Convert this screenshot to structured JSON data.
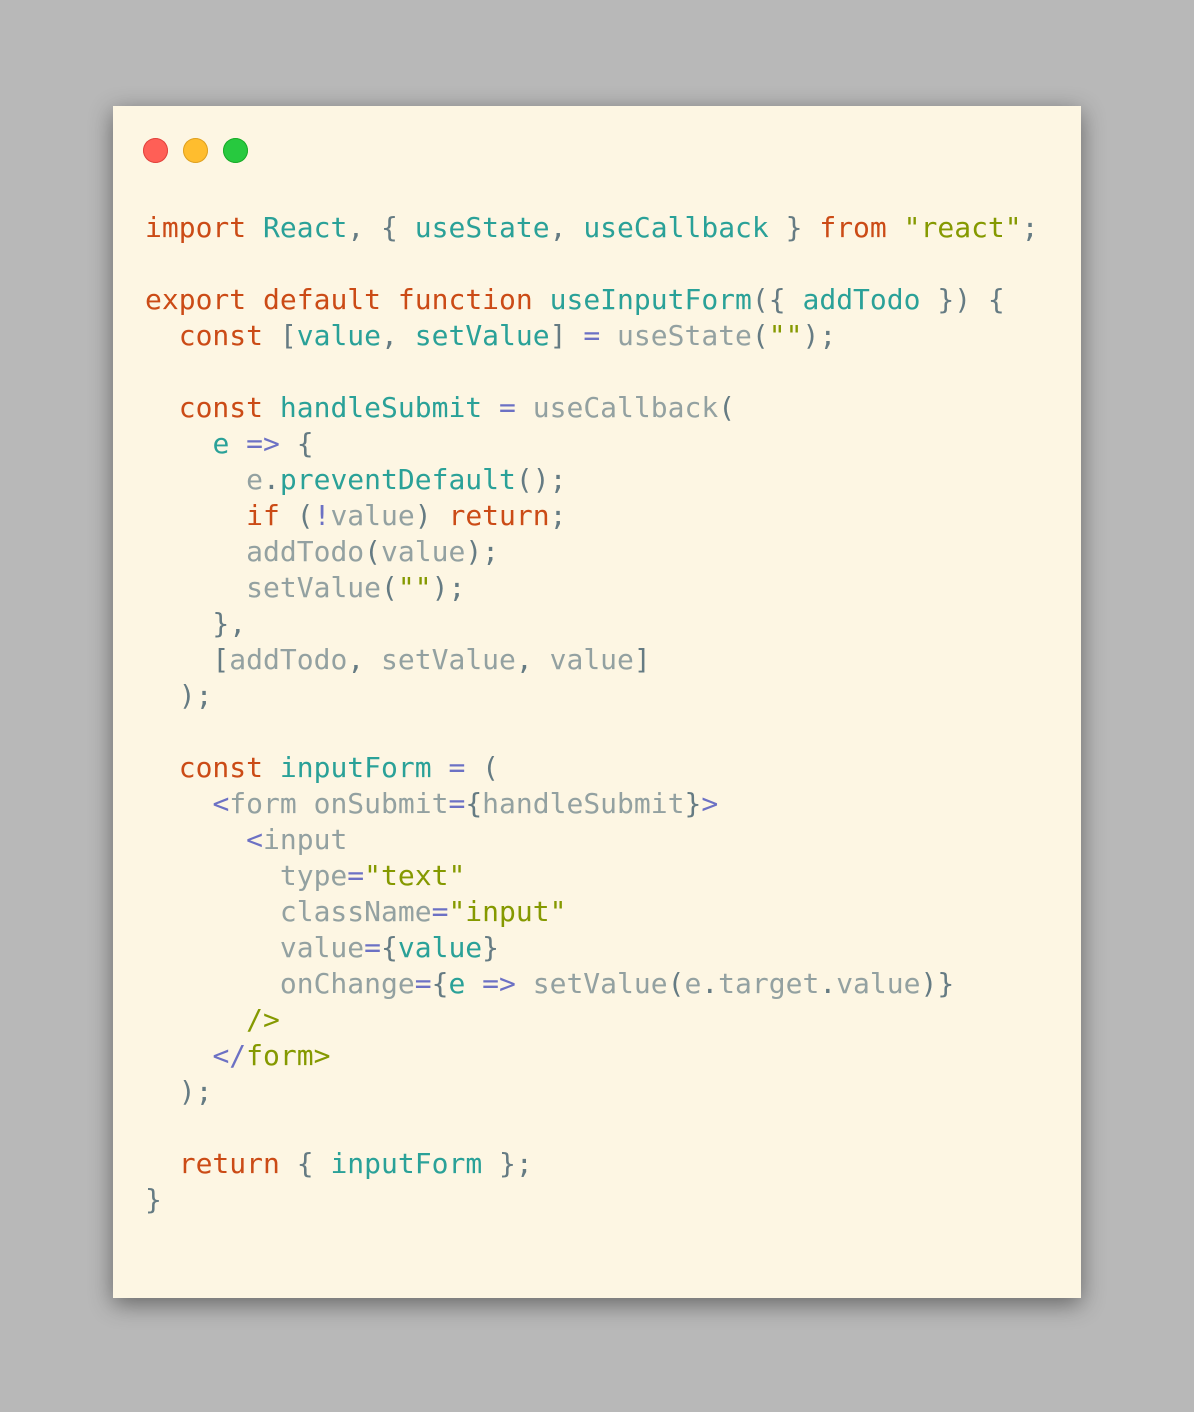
{
  "window": {
    "buttons": [
      "close",
      "minimize",
      "maximize"
    ]
  },
  "code": {
    "language": "javascript",
    "lines": [
      [
        [
          "k",
          "import"
        ],
        [
          "p",
          " "
        ],
        [
          "v",
          "React"
        ],
        [
          "p",
          ", { "
        ],
        [
          "v",
          "useState"
        ],
        [
          "p",
          ", "
        ],
        [
          "v",
          "useCallback"
        ],
        [
          "p",
          " } "
        ],
        [
          "k",
          "from"
        ],
        [
          "p",
          " "
        ],
        [
          "s",
          "\"react\""
        ],
        [
          "p",
          ";"
        ]
      ],
      [],
      [
        [
          "k",
          "export"
        ],
        [
          "p",
          " "
        ],
        [
          "k",
          "default"
        ],
        [
          "p",
          " "
        ],
        [
          "k",
          "function"
        ],
        [
          "p",
          " "
        ],
        [
          "v",
          "useInputForm"
        ],
        [
          "p",
          "({ "
        ],
        [
          "v",
          "addTodo"
        ],
        [
          "p",
          " }) {"
        ]
      ],
      [
        [
          "p",
          "  "
        ],
        [
          "k",
          "const"
        ],
        [
          "p",
          " ["
        ],
        [
          "v",
          "value"
        ],
        [
          "p",
          ", "
        ],
        [
          "v",
          "setValue"
        ],
        [
          "p",
          "] "
        ],
        [
          "o",
          "="
        ],
        [
          "p",
          " "
        ],
        [
          "f",
          "useState"
        ],
        [
          "p",
          "("
        ],
        [
          "s",
          "\"\""
        ],
        [
          "p",
          ");"
        ]
      ],
      [],
      [
        [
          "p",
          "  "
        ],
        [
          "k",
          "const"
        ],
        [
          "p",
          " "
        ],
        [
          "v",
          "handleSubmit"
        ],
        [
          "p",
          " "
        ],
        [
          "o",
          "="
        ],
        [
          "p",
          " "
        ],
        [
          "f",
          "useCallback"
        ],
        [
          "p",
          "("
        ]
      ],
      [
        [
          "p",
          "    "
        ],
        [
          "v",
          "e"
        ],
        [
          "p",
          " "
        ],
        [
          "o",
          "=>"
        ],
        [
          "p",
          " {"
        ]
      ],
      [
        [
          "p",
          "      "
        ],
        [
          "f",
          "e"
        ],
        [
          "p",
          "."
        ],
        [
          "v",
          "preventDefault"
        ],
        [
          "p",
          "();"
        ]
      ],
      [
        [
          "p",
          "      "
        ],
        [
          "k",
          "if"
        ],
        [
          "p",
          " ("
        ],
        [
          "o",
          "!"
        ],
        [
          "f",
          "value"
        ],
        [
          "p",
          ") "
        ],
        [
          "k",
          "return"
        ],
        [
          "p",
          ";"
        ]
      ],
      [
        [
          "p",
          "      "
        ],
        [
          "f",
          "addTodo"
        ],
        [
          "p",
          "("
        ],
        [
          "f",
          "value"
        ],
        [
          "p",
          ");"
        ]
      ],
      [
        [
          "p",
          "      "
        ],
        [
          "f",
          "setValue"
        ],
        [
          "p",
          "("
        ],
        [
          "s",
          "\"\""
        ],
        [
          "p",
          ");"
        ]
      ],
      [
        [
          "p",
          "    },"
        ]
      ],
      [
        [
          "p",
          "    ["
        ],
        [
          "f",
          "addTodo"
        ],
        [
          "p",
          ", "
        ],
        [
          "f",
          "setValue"
        ],
        [
          "p",
          ", "
        ],
        [
          "f",
          "value"
        ],
        [
          "p",
          "]"
        ]
      ],
      [
        [
          "p",
          "  );"
        ]
      ],
      [],
      [
        [
          "p",
          "  "
        ],
        [
          "k",
          "const"
        ],
        [
          "p",
          " "
        ],
        [
          "v",
          "inputForm"
        ],
        [
          "p",
          " "
        ],
        [
          "o",
          "="
        ],
        [
          "p",
          " ("
        ]
      ],
      [
        [
          "p",
          "    "
        ],
        [
          "o",
          "<"
        ],
        [
          "f",
          "form"
        ],
        [
          "p",
          " "
        ],
        [
          "f",
          "onSubmit"
        ],
        [
          "o",
          "="
        ],
        [
          "p",
          "{"
        ],
        [
          "f",
          "handleSubmit"
        ],
        [
          "p",
          "}"
        ],
        [
          "o",
          ">"
        ]
      ],
      [
        [
          "p",
          "      "
        ],
        [
          "o",
          "<"
        ],
        [
          "f",
          "input"
        ]
      ],
      [
        [
          "p",
          "        "
        ],
        [
          "f",
          "type"
        ],
        [
          "o",
          "="
        ],
        [
          "s",
          "\"text\""
        ]
      ],
      [
        [
          "p",
          "        "
        ],
        [
          "f",
          "className"
        ],
        [
          "o",
          "="
        ],
        [
          "s",
          "\"input\""
        ]
      ],
      [
        [
          "p",
          "        "
        ],
        [
          "f",
          "value"
        ],
        [
          "o",
          "="
        ],
        [
          "p",
          "{"
        ],
        [
          "v",
          "value"
        ],
        [
          "p",
          "}"
        ]
      ],
      [
        [
          "p",
          "        "
        ],
        [
          "f",
          "onChange"
        ],
        [
          "o",
          "="
        ],
        [
          "p",
          "{"
        ],
        [
          "v",
          "e"
        ],
        [
          "p",
          " "
        ],
        [
          "o",
          "=>"
        ],
        [
          "p",
          " "
        ],
        [
          "f",
          "setValue"
        ],
        [
          "p",
          "("
        ],
        [
          "f",
          "e"
        ],
        [
          "p",
          "."
        ],
        [
          "f",
          "target"
        ],
        [
          "p",
          "."
        ],
        [
          "f",
          "value"
        ],
        [
          "p",
          ")}"
        ]
      ],
      [
        [
          "p",
          "      "
        ],
        [
          "s",
          "/>"
        ]
      ],
      [
        [
          "p",
          "    "
        ],
        [
          "o",
          "</"
        ],
        [
          "s",
          "form>"
        ]
      ],
      [
        [
          "p",
          "  );"
        ]
      ],
      [],
      [
        [
          "p",
          "  "
        ],
        [
          "k",
          "return"
        ],
        [
          "p",
          " { "
        ],
        [
          "v",
          "inputForm"
        ],
        [
          "p",
          " };"
        ]
      ],
      [
        [
          "p",
          "}"
        ]
      ]
    ]
  }
}
